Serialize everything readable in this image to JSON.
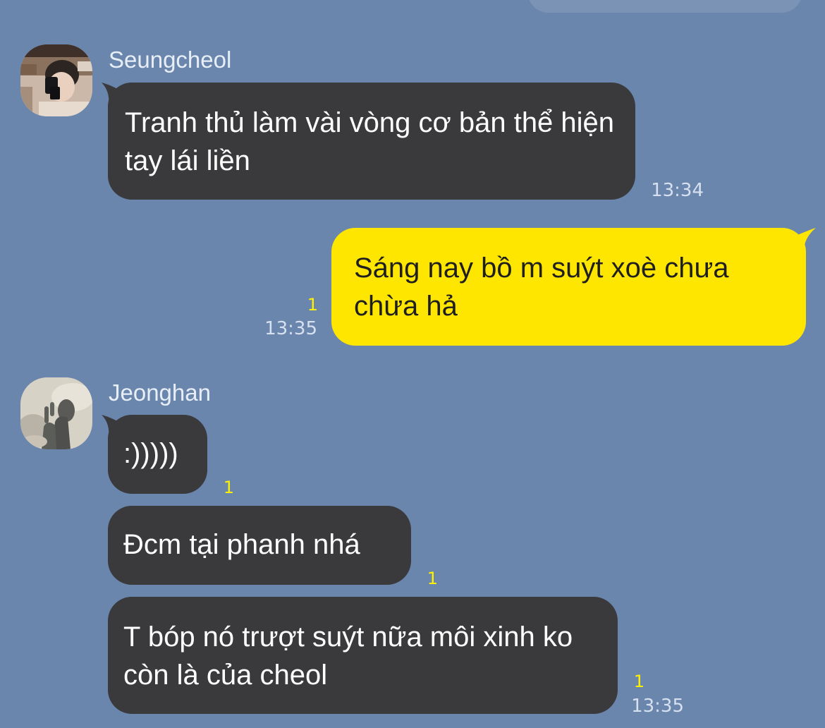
{
  "colors": {
    "background": "#6a86ad",
    "incoming_bubble": "#3a3a3d",
    "outgoing_bubble": "#ffe600",
    "unread_count": "#fff100",
    "timestamp": "#d6e0ee"
  },
  "chat": {
    "messages": [
      {
        "sender": "Seungcheol",
        "avatar_icon": "profile-photo-avatar",
        "text": "Tranh thủ làm vài vòng cơ bản thể hiện tay lái liền",
        "time": "13:34",
        "direction": "incoming"
      },
      {
        "text": "Sáng nay bồ m suýt xoè chưa chừa hả",
        "unread_count": "1",
        "time": "13:35",
        "direction": "outgoing"
      },
      {
        "sender": "Jeonghan",
        "avatar_icon": "profile-photo-avatar",
        "text": ":)))))",
        "unread_count": "1",
        "direction": "incoming"
      },
      {
        "text": "Đcm tại phanh nhá",
        "unread_count": "1",
        "direction": "incoming"
      },
      {
        "text": "T bóp nó trượt suýt nữa môi xinh ko còn là của cheol",
        "unread_count": "1",
        "time": "13:35",
        "direction": "incoming"
      }
    ]
  }
}
